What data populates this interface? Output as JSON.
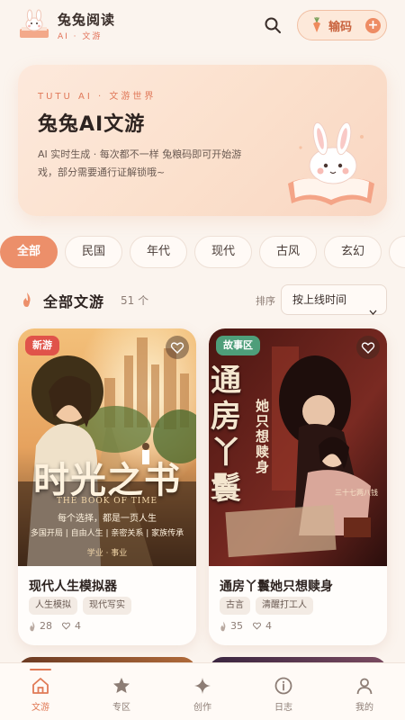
{
  "header": {
    "app_name": "兔兔阅读",
    "app_sub": "AI · 文游",
    "redeem_label": "输码",
    "icons": [
      "rabbit-logo-icon",
      "search-icon",
      "carrot-icon",
      "plus-icon"
    ]
  },
  "hero": {
    "kicker": "TUTU AI · 文游世界",
    "title": "兔兔AI文游",
    "description": "AI 实时生成 · 每次都不一样 兔粮码即可开始游戏，部分需要通行证解锁哦~"
  },
  "filters": {
    "items": [
      "全部",
      "民国",
      "年代",
      "现代",
      "古风",
      "玄幻"
    ],
    "active": "全部"
  },
  "section": {
    "title": "全部文游",
    "count": "51 个",
    "sort_label": "排序",
    "sort_value": "按上线时间"
  },
  "cards": [
    {
      "badge": "新游",
      "badge_color": "#e0534a",
      "cover_title": "时光之书",
      "cover_subtitle": "THE BOOK OF TIME",
      "cover_tagline": "每个选择，都是一页人生",
      "cover_features": "多国开局 | 自由人生 | 亲密关系 | 家族传承",
      "cover_footer": "学业 · 事业",
      "title": "现代人生模拟器",
      "tags": [
        "人生模拟",
        "现代写实"
      ],
      "plays": "28",
      "likes": "4"
    },
    {
      "badge": "故事区",
      "badge_color": "#4e9e7a",
      "cover_title": "通房丫鬟",
      "cover_title2": "她只想赎身",
      "cover_caption": "三十七两八钱",
      "title": "通房丫鬟她只想赎身",
      "tags": [
        "古言",
        "清醒打工人"
      ],
      "plays": "35",
      "likes": "4"
    }
  ],
  "nav": {
    "items": [
      {
        "label": "文游",
        "icon": "home-icon"
      },
      {
        "label": "专区",
        "icon": "star-icon"
      },
      {
        "label": "创作",
        "icon": "sparkle-icon"
      },
      {
        "label": "日志",
        "icon": "info-icon"
      },
      {
        "label": "我的",
        "icon": "user-icon"
      }
    ],
    "active": "文游"
  },
  "colors": {
    "accent": "#ec8f6a",
    "background": "#fbf4ee",
    "new_badge": "#e0534a",
    "story_badge": "#4e9e7a"
  }
}
